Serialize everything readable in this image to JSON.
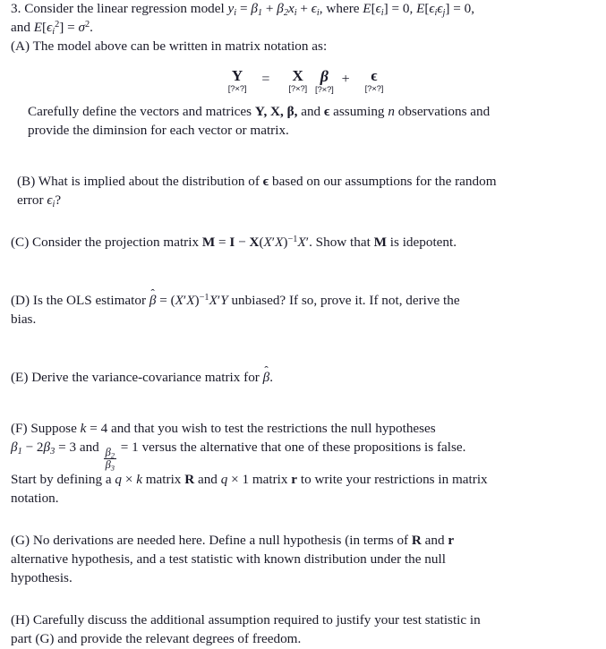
{
  "document": {
    "type": "econometrics-problem-set",
    "problem_number": "3.",
    "text_color": "#1a1a28",
    "background_color": "#ffffff"
  },
  "problem": {
    "stem": {
      "lead": "3. Consider the linear regression model",
      "model_eq": "y_i = β_1 + β_2 x_i + ϵ_i",
      "where_word": "where",
      "cond1": "E[ϵ_i] = 0,",
      "cond2": "E[ϵ_i ϵ_j] = 0,",
      "and_word": "and",
      "cond3": "E[ϵ_i^2] = σ^2.",
      "y": "y",
      "i": "i",
      "eq": "=",
      "beta": "β",
      "one": "1",
      "plus": "+",
      "two": "2",
      "x": "x",
      "epsilon": "ϵ",
      "comma": ",",
      "E": "E",
      "lb": "[",
      "rb": "]",
      "zero": "0",
      "j": "j",
      "sigma": "σ",
      "sup2": "2",
      "period": "."
    },
    "parts": [
      {
        "label": "(A)",
        "text": "The model above can be written in matrix notation as:",
        "equation": {
          "terms": [
            {
              "symbol": "Y",
              "style": "bold-upright",
              "dim": "[?×?]"
            },
            {
              "symbol": "X",
              "style": "bold-upright",
              "dim": "[?×?]"
            },
            {
              "symbol": "β",
              "style": "bold-italic",
              "dim": "[?×?]"
            },
            {
              "symbol": "ϵ",
              "style": "bold-upright",
              "dim": "[?×?]"
            }
          ],
          "equals": "=",
          "plus": "+"
        },
        "followup_line1_a": "Carefully define the vectors and matrices",
        "followup_symbols": "Y, X, β,",
        "followup_line1_b": "and",
        "followup_eps": "ϵ",
        "followup_line1_c": "assuming",
        "followup_n": "n",
        "followup_line1_d": "observations and",
        "followup_line2": "provide the diminsion for each vector or matrix."
      },
      {
        "label": "(B)",
        "line1_a": "What is implied about the distribution of",
        "line1_eps": "ϵ",
        "line1_b": "based on our assumptions for the random",
        "line2_a": "error",
        "line2_eps": "ϵ",
        "line2_sub": "i",
        "line2_b": "?"
      },
      {
        "label": "(C)",
        "text_a": "Consider the projection matrix",
        "formula": "M = I − X(X′X)⁻¹X′.",
        "text_b": "Show that",
        "M": "M",
        "text_c": "is idepotent.",
        "M_sym": "M",
        "I_sym": "I",
        "X_sym": "X",
        "minus": "−",
        "equals": "=",
        "lparen": "(",
        "rparen": ")",
        "prime": "′",
        "exp": "−1",
        "dot": "."
      },
      {
        "label": "(D)",
        "text_a": "Is the OLS estimator",
        "formula": "β̂ = (X′X)⁻¹X′Y",
        "text_b": "unbiased? If so, prove it. If not, derive the",
        "line2": "bias.",
        "beta": "β",
        "hat": "ˆ",
        "equals": "=",
        "lparen": "(",
        "rparen": ")",
        "X": "X",
        "prime": "′",
        "exp": "−1",
        "Y": "Y"
      },
      {
        "label": "(E)",
        "text_a": "Derive the variance-covariance matrix for",
        "beta": "β",
        "hat": "ˆ",
        "text_b": "."
      },
      {
        "label": "(F)",
        "line1_a": "Suppose",
        "k": "k",
        "eq": "=",
        "four": "4",
        "line1_b": "and that you wish to test the restrictions the null hypotheses",
        "line2_r1": "β₁ − 2β₃ = 3",
        "beta": "β",
        "sub1": "1",
        "minus": "−",
        "two": "2",
        "sub3": "3",
        "equals": "=",
        "three": "3",
        "and_word": "and",
        "frac_num_sub": "2",
        "frac_den_sub": "3",
        "one": "1",
        "line2_b": "versus the alternative that one of these propositions is false.",
        "line3_a": "Start by defining a",
        "q": "q",
        "times": "×",
        "k2": "k",
        "line3_b": "matrix",
        "R": "R",
        "line3_c": "and",
        "q2": "q",
        "times2": "×",
        "one2": "1",
        "line3_d": "matrix",
        "r": "r",
        "line3_e": "to write your restrictions in matrix",
        "line4": "notation."
      },
      {
        "label": "(G)",
        "line1_a": "No derivations are needed here. Define a null hypothesis (in terms of",
        "R": "R",
        "line1_b": "and",
        "r": "r",
        "line2": "alternative hypothesis, and a test statistic with known distribution under the null",
        "line3": "hypothesis."
      },
      {
        "label": "(H)",
        "line1": "Carefully discuss the additional assumption required to justify your test statistic in",
        "line2": "part (G) and provide the relevant degrees of freedom."
      }
    ]
  }
}
